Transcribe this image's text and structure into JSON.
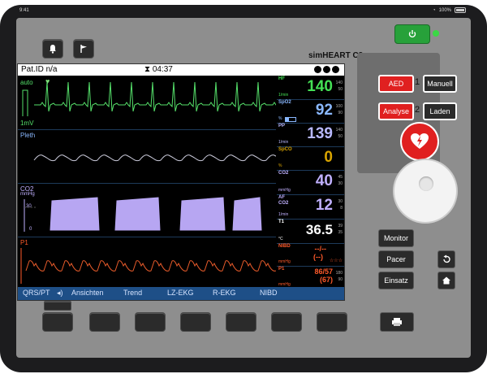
{
  "statusbar": {
    "time": "9:41",
    "battery": "100%"
  },
  "monitor": {
    "patient_id": "Pat.ID n/a",
    "timer": "04:37",
    "brand": "simHEART C3"
  },
  "waves": {
    "ecg": {
      "mode": "auto",
      "scale": "1mV"
    },
    "pleth": {
      "label": "Pleth"
    },
    "co2": {
      "label": "CO2",
      "unit": "mmHg",
      "scale_30": "30",
      "scale_0": "0"
    },
    "p1": {
      "label": "P1"
    }
  },
  "params": {
    "hf": {
      "label": "HF",
      "unit": "1/min",
      "value": "140",
      "hi": "140",
      "lo": "50"
    },
    "spo2": {
      "label": "SpO2",
      "unit": "%",
      "value": "92",
      "hi": "100",
      "lo": "90"
    },
    "pp": {
      "label": "PP",
      "unit": "1/min",
      "value": "139",
      "hi": "140",
      "lo": "50"
    },
    "spco": {
      "label": "SpCO",
      "unit": "%",
      "value": "0"
    },
    "co2": {
      "label": "CO2",
      "unit": "mmHg",
      "value": "40",
      "hi": "45",
      "lo": "30"
    },
    "af": {
      "label": "AF",
      "label2": "CO2",
      "unit": "1/min",
      "value": "12",
      "hi": "30",
      "lo": "8"
    },
    "t1": {
      "label": "T1",
      "unit": "°C",
      "value": "36.5",
      "hi": "39",
      "lo": "35"
    },
    "nibd": {
      "label": "NIBD",
      "unit": "mmHg",
      "value": "--/--",
      "value2": "(--)",
      "stars": "☆☆☆"
    },
    "p1": {
      "label": "P1",
      "unit": "mmHg",
      "value": "86/57",
      "value2": "(67)",
      "hi": "180",
      "lo": "90"
    }
  },
  "softkeys": [
    "QRS/PT",
    "Ansichten",
    "Trend",
    "LZ-EKG",
    "R-EKG",
    "NIBD"
  ],
  "controls": {
    "aed": "AED",
    "num1": "1",
    "manual": "Manuell",
    "analyse": "Analyse",
    "num2": "2",
    "laden": "Laden",
    "monitor": "Monitor",
    "pacer": "Pacer",
    "einsatz": "Einsatz"
  },
  "colors": {
    "hf": "#44e055",
    "spo2": "#8ab8ff",
    "pp": "#b9b9ff",
    "spco": "#d9a400",
    "co2": "#c0b0ff",
    "t1": "#ffffff",
    "nibd": "#ff5a2a",
    "p1": "#ff5a2a",
    "device": "#8e8e8e",
    "softbar": "#1e4f87"
  }
}
